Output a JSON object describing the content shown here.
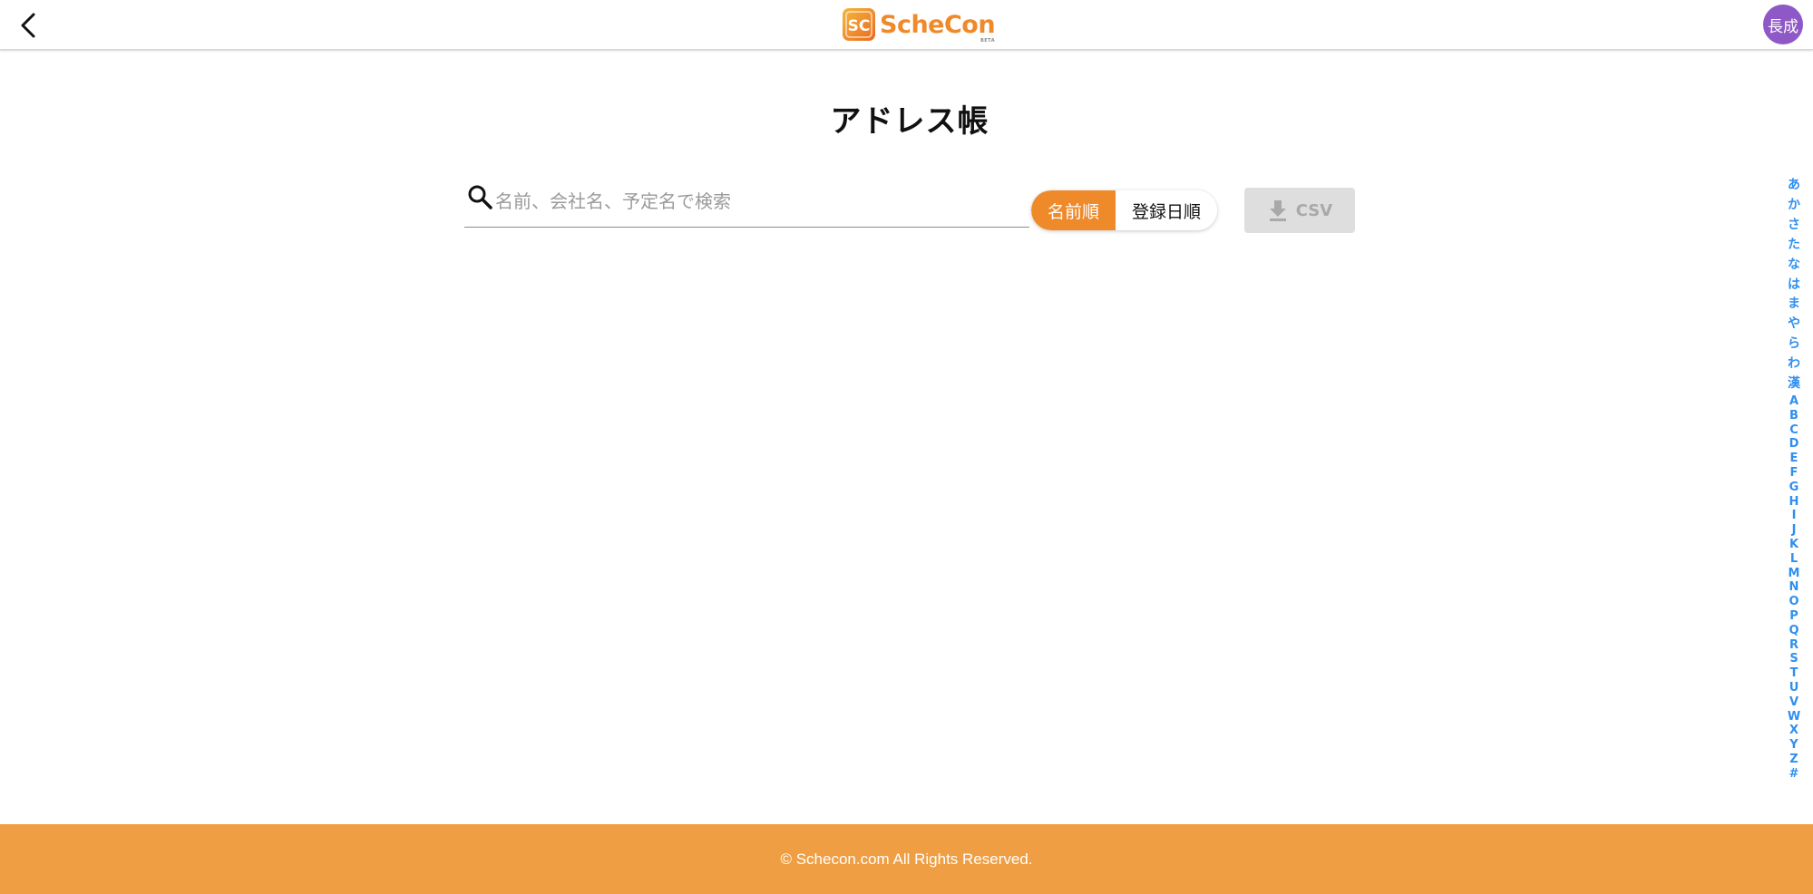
{
  "header": {
    "back_icon": "chevron-left-icon",
    "logo_text": "ScheCon",
    "logo_mark_text": "SC",
    "logo_badge": "BETA",
    "avatar_text": "長成",
    "colors": {
      "accent": "#ef8a2b",
      "avatar": "#8e58c7"
    }
  },
  "page": {
    "title": "アドレス帳"
  },
  "search": {
    "icon": "search-icon",
    "placeholder": "名前、会社名、予定名で検索",
    "value": ""
  },
  "sort": {
    "name_label": "名前順",
    "date_label": "登録日順",
    "selected": "名前順"
  },
  "csv": {
    "icon": "download-icon",
    "label": "CSV",
    "disabled": true
  },
  "index_bar": {
    "kana": [
      "あ",
      "か",
      "さ",
      "た",
      "な",
      "は",
      "ま",
      "や",
      "ら",
      "わ",
      "漢"
    ],
    "alpha": [
      "A",
      "B",
      "C",
      "D",
      "E",
      "F",
      "G",
      "H",
      "I",
      "J",
      "K",
      "L",
      "M",
      "N",
      "O",
      "P",
      "Q",
      "R",
      "S",
      "T",
      "U",
      "V",
      "W",
      "X",
      "Y",
      "Z",
      "#"
    ],
    "color": "#2f8fef"
  },
  "footer": {
    "text": "© Schecon.com All Rights Reserved.",
    "color": "#ef9e44"
  }
}
